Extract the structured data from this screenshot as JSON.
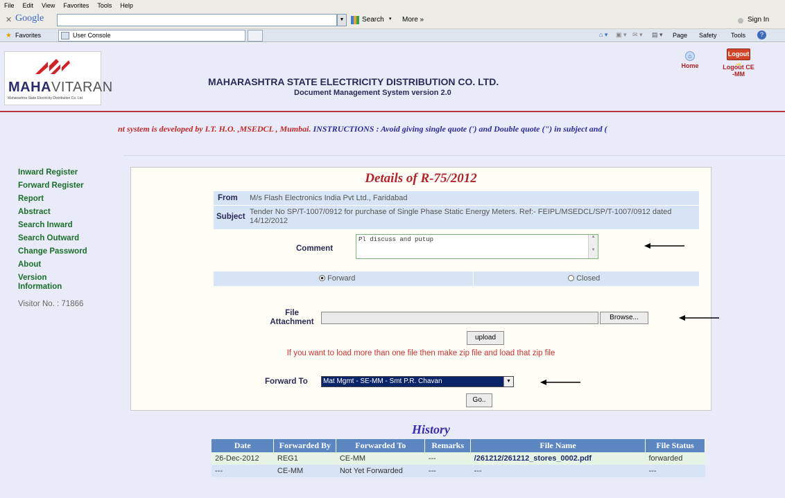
{
  "browser": {
    "menu": [
      "File",
      "Edit",
      "View",
      "Favorites",
      "Tools",
      "Help"
    ],
    "google_logo": "Google",
    "search_label": "Search",
    "more_label": "More »",
    "sign_in_label": "Sign In",
    "favorites_label": "Favorites",
    "tab_title": "User Console",
    "tools_bar": [
      "Page",
      "Safety",
      "Tools"
    ]
  },
  "header": {
    "logo_text_bold": "MAHA",
    "logo_text_light": "VITARAN",
    "logo_subtext": "Maharashtra State Electricity Distribution Co. Ltd.",
    "title": "MAHARASHTRA STATE ELECTRICITY DISTRIBUTION CO. LTD.",
    "subtitle": "Document Management System version 2.0",
    "home_label": "Home",
    "logout_button": "Logout",
    "logout_label": "Logout CE -MM"
  },
  "marquee": {
    "text_red": "nt system is developed by I.T. H.O. ,MSEDCL , Mumbai.",
    "text_blue": "INSTRUCTIONS : Avoid giving single quote (') and Double quote (\") in subject and ("
  },
  "sidebar": {
    "items": [
      "Inward Register",
      "Forward Register",
      "Report",
      "Abstract",
      "Search Inward",
      "Search Outward",
      "Change Password",
      "About",
      "Version Information"
    ],
    "visitor": "Visitor No. : 71866"
  },
  "details": {
    "title": "Details of R-75/2012",
    "from_label": "From",
    "from_value": "M/s Flash Electronics India Pvt Ltd., Faridabad",
    "subject_label": "Subject",
    "subject_value": "Tender No SP/T-1007/0912 for purchase of Single Phase Static Energy Meters. Ref:- FEIPL/MSEDCL/SP/T-1007/0912 dated 14/12/2012",
    "comment_label": "Comment",
    "comment_value": "Pl discuss and putup",
    "radio_forward": "Forward",
    "radio_closed": "Closed",
    "file_label": "File Attachment",
    "browse_button": "Browse...",
    "upload_button": "upload",
    "zip_note": "If you want to load more than one file then make zip file and load that zip file",
    "forward_to_label": "Forward To",
    "forward_to_value": "Mat Mgmt - SE-MM - Smt P.R. Chavan",
    "go_button": "Go.."
  },
  "history": {
    "title": "History",
    "columns": [
      "Date",
      "Forwarded By",
      "Forwarded To",
      "Remarks",
      "File Name",
      "File Status"
    ],
    "rows": [
      [
        "26-Dec-2012",
        "REG1",
        "CE-MM",
        "---",
        "/261212/261212_stores_0002.pdf",
        "forwarded"
      ],
      [
        "---",
        "CE-MM",
        "Not Yet Forwarded",
        "---",
        "---",
        "---"
      ]
    ]
  },
  "colors": {
    "nav_green": "#1a6e2a",
    "title_navy": "#2a2a56",
    "history_header": "#5c86c2",
    "accent_red": "#b8373a"
  }
}
